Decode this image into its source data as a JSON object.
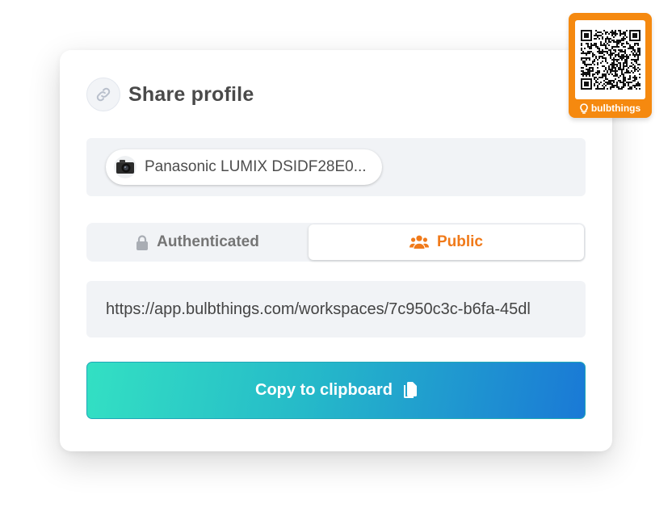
{
  "header": {
    "title": "Share profile",
    "icon": "link-icon"
  },
  "device": {
    "name": "Panasonic LUMIX DSIDF28E0...",
    "icon": "camera-icon"
  },
  "access_toggle": {
    "options": [
      {
        "label": "Authenticated",
        "icon": "lock-icon",
        "selected": false
      },
      {
        "label": "Public",
        "icon": "users-icon",
        "selected": true
      }
    ]
  },
  "share_url": {
    "value": "https://app.bulbthings.com/workspaces/7c950c3c-b6fa-45dl"
  },
  "copy_button": {
    "label": "Copy to clipboard",
    "icon": "clipboard-icon"
  },
  "qr_tag": {
    "brand": "bulbthings",
    "icon": "qr-code-icon"
  },
  "colors": {
    "accent_orange": "#f07a1a",
    "tag_orange": "#f5890f",
    "button_gradient_start": "#33e0c3",
    "button_gradient_end": "#1a79d6",
    "panel_bg": "#f1f3f6"
  }
}
